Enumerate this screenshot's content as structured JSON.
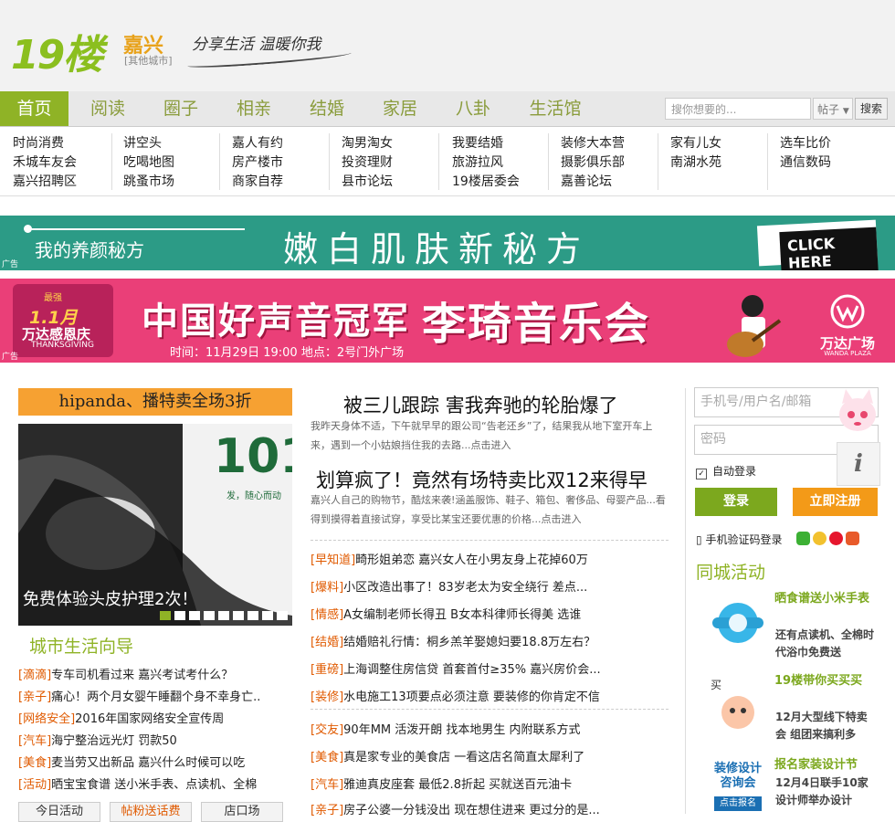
{
  "site": {
    "logo_number": "19",
    "logo_char": "楼",
    "city": "嘉兴",
    "other_city": "[其他城市]",
    "slogan": "分享生活 温暖你我"
  },
  "nav": {
    "items": [
      "首页",
      "阅读",
      "圈子",
      "相亲",
      "结婚",
      "家居",
      "八卦",
      "生活馆"
    ],
    "active_index": 0,
    "search_placeholder": "搜你想要的...",
    "search_type": "帖子",
    "search_button": "搜索"
  },
  "sublinks": {
    "columns": [
      [
        "时尚消费",
        "禾城车友会",
        "嘉兴招聘区"
      ],
      [
        "讲空头",
        "吃喝地图",
        "跳蚤市场"
      ],
      [
        "嘉人有约",
        "房产楼市",
        "商家自荐"
      ],
      [
        "淘男淘女",
        "投资理财",
        "县市论坛"
      ],
      [
        "我要结婚",
        "旅游拉风",
        "19楼居委会"
      ],
      [
        "装修大本营",
        "摄影俱乐部",
        "嘉善论坛"
      ],
      [
        "家有儿女",
        "南湖水苑"
      ],
      [
        "选车比价",
        "通信数码"
      ]
    ]
  },
  "ads": {
    "tag": "广告",
    "banner1": {
      "left_text": "我的养颜秘方",
      "main_text": "嫩白肌肤新秘方",
      "button": "CLICK HERE"
    },
    "banner2": {
      "badge_top": "最强",
      "badge_main": "1.1月",
      "badge_sub": "万达感恩庆",
      "badge_en": "THANKSGIVING",
      "title1": "中国好声音冠军",
      "title2": "李琦音乐会",
      "info": "时间：11月29日 19:00  地点：2号门外广场",
      "brand": "万达广场",
      "brand_en": "WANDA PLAZA"
    }
  },
  "left": {
    "promo_title": "hipanda、播特卖全场3折",
    "promo_img_text": "101",
    "promo_img_sub": "发，随心而动",
    "promo_caption": "免费体验头皮护理2次！",
    "section_title": "城市生活向导",
    "guide": [
      {
        "tag": "[滴滴]",
        "text": "专车司机看过来 嘉兴考试考什么？"
      },
      {
        "tag": "[亲子]",
        "text": "痛心！两个月女婴午睡翻个身不幸身亡..."
      },
      {
        "tag": "[网络安全]",
        "text": "2016年国家网络安全宣传周"
      },
      {
        "tag": "[汽车]",
        "text": "海宁整治远光灯 罚款50"
      },
      {
        "tag": "[美食]",
        "text": "麦当劳又出新品 嘉兴什么时候可以吃"
      },
      {
        "tag": "[活动]",
        "text": "晒宝宝食谱 送小米手表、点读机、全棉"
      }
    ],
    "tabs": [
      "今日活动",
      "帖粉送话费",
      "店口场"
    ]
  },
  "middle": {
    "headline1": "被三儿跟踪 害我奔驰的轮胎爆了",
    "desc1": "我昨天身体不适，下午就早早的跟公司“告老还乡”了，结果我从地下室开车上来，遇到一个小姑娘挡住我的去路...点击进入",
    "headline2": "划算疯了！竟然有场特卖比双12来得早",
    "desc2": "嘉兴人自己的购物节，酷炫来袭!涵盖服饰、鞋子、箱包、奢侈品、母婴产品...看得到摸得着直接试穿，享受比某宝还要优惠的价格...点击进入",
    "news": [
      {
        "tag": "[早知道]",
        "text": "畸形姐弟恋 嘉兴女人在小男友身上花掉60万"
      },
      {
        "tag": "[爆料]",
        "text": "小区改造出事了！83岁老太为安全绕行 差点..."
      },
      {
        "tag": "[情感]",
        "text": "A女编制老师长得丑 B女本科律师长得美 选谁"
      },
      {
        "tag": "[结婚]",
        "text": "结婚赔礼行情：桐乡羔羊娶媳妇要18.8万左右？"
      },
      {
        "tag": "[重磅]",
        "text": "上海调整住房信贷 首套首付≥35% 嘉兴房价会..."
      },
      {
        "tag": "[装修]",
        "text": "水电施工13项要点必须注意 要装修的你肯定不信"
      },
      {
        "tag": "[交友]",
        "text": "90年MM 活泼开朗 找本地男生 内附联系方式"
      },
      {
        "tag": "[美食]",
        "text": "真是家专业的美食店 一看这店名简直太犀利了"
      },
      {
        "tag": "[汽车]",
        "text": "雅迪真皮座套 最低2.8折起 买就送百元油卡"
      },
      {
        "tag": "[亲子]",
        "text": "房子公婆一分钱没出 现在想住进来 更过分的是..."
      }
    ]
  },
  "right": {
    "username_placeholder": "手机号/用户名/邮箱",
    "password_placeholder": "密码",
    "remember": "自动登录",
    "login_button": "登录",
    "register_button": "立即注册",
    "sms_login": "手机验证码登录",
    "section_title": "同城活动",
    "activities": [
      {
        "title": "晒食谱送小米手表",
        "desc": "还有点读机、全棉时代浴巾免费送"
      },
      {
        "title": "19楼带你买买买",
        "desc": "12月大型线下特卖会 组团来搞利多"
      },
      {
        "title": "报名家装设计节",
        "desc": "12月4日联手10家设计师举办设计"
      }
    ],
    "act3_img_text1": "装修设计",
    "act3_img_text2": "咨询会",
    "act3_img_btn": "点击报名",
    "info_icon": "i"
  },
  "colors": {
    "brand_green": "#8fb326",
    "accent_orange": "#f39a18",
    "tag_orange": "#e05a00",
    "ad1_bg": "#2c9b86",
    "ad2_bg": "#ea3f78"
  }
}
